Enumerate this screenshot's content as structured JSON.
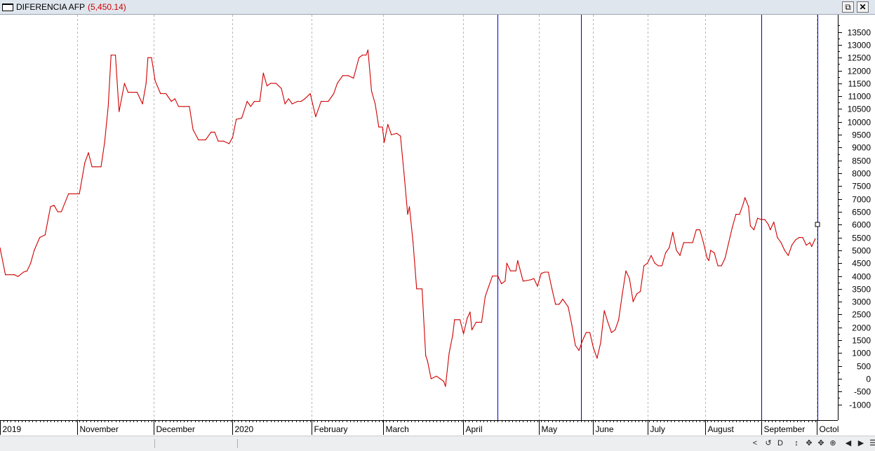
{
  "window": {
    "title": "DIFERENCIA AFP",
    "last_value": "(5,450.14)",
    "restore_icon": "restore-icon",
    "close_icon": "close-icon"
  },
  "colors": {
    "series": "#d00000",
    "markers": "#0000c8",
    "grid": "#b8b8b8",
    "axis": "#000000"
  },
  "chart_data": {
    "type": "line",
    "title": "DIFERENCIA AFP",
    "xlabel": "",
    "ylabel": "",
    "ylim": [
      -1500,
      14000
    ],
    "grid": "vertical dashed at month boundaries",
    "x_unit": "trading days",
    "x_range": [
      0,
      240
    ],
    "y_ticks": [
      -1000,
      -500,
      0,
      500,
      1000,
      1500,
      2000,
      2500,
      3000,
      3500,
      4000,
      4500,
      5000,
      5500,
      6000,
      6500,
      7000,
      7500,
      8000,
      8500,
      9000,
      9500,
      10000,
      10500,
      11000,
      11500,
      12000,
      12500,
      13000,
      13500
    ],
    "x_labels": [
      {
        "label": "2019",
        "x": 0
      },
      {
        "label": "November",
        "x": 21.4
      },
      {
        "label": "December",
        "x": 42.6
      },
      {
        "label": "2020",
        "x": 64.4
      },
      {
        "label": "February",
        "x": 86.4
      },
      {
        "label": "March",
        "x": 106.2
      },
      {
        "label": "April",
        "x": 128.3
      },
      {
        "label": "May",
        "x": 149.3
      },
      {
        "label": "June",
        "x": 164.3
      },
      {
        "label": "July",
        "x": 179.5
      },
      {
        "label": "August",
        "x": 195.5
      },
      {
        "label": "September",
        "x": 211
      },
      {
        "label": "Octol",
        "x": 226.4
      }
    ],
    "vertical_markers": [
      138,
      161,
      211,
      226.6
    ],
    "series": [
      {
        "points": [
          [
            0,
            5100
          ],
          [
            1.5,
            4050
          ],
          [
            4,
            4050
          ],
          [
            5,
            3980
          ],
          [
            6.5,
            4150
          ],
          [
            7.5,
            4200
          ],
          [
            8.5,
            4500
          ],
          [
            9.5,
            5000
          ],
          [
            11,
            5500
          ],
          [
            12.5,
            5600
          ],
          [
            14,
            6700
          ],
          [
            15,
            6750
          ],
          [
            16,
            6500
          ],
          [
            17,
            6500
          ],
          [
            19,
            7200
          ],
          [
            20,
            7200
          ],
          [
            22,
            7200
          ],
          [
            23.5,
            8400
          ],
          [
            24.5,
            8800
          ],
          [
            25.5,
            8250
          ],
          [
            26.5,
            8250
          ],
          [
            28,
            8250
          ],
          [
            29,
            9200
          ],
          [
            30,
            10600
          ],
          [
            30.8,
            12600
          ],
          [
            32,
            12600
          ],
          [
            33,
            10400
          ],
          [
            34.5,
            11500
          ],
          [
            35.5,
            11150
          ],
          [
            38,
            11150
          ],
          [
            39.5,
            10700
          ],
          [
            40.5,
            11500
          ],
          [
            41,
            12500
          ],
          [
            42,
            12500
          ],
          [
            43,
            11600
          ],
          [
            44.5,
            11100
          ],
          [
            46,
            11100
          ],
          [
            47.5,
            10800
          ],
          [
            48.5,
            10900
          ],
          [
            49.5,
            10600
          ],
          [
            51,
            10600
          ],
          [
            52.5,
            10600
          ],
          [
            53.5,
            9700
          ],
          [
            55,
            9300
          ],
          [
            57,
            9300
          ],
          [
            58.5,
            9600
          ],
          [
            59.5,
            9600
          ],
          [
            60.5,
            9250
          ],
          [
            62,
            9250
          ],
          [
            63.5,
            9150
          ],
          [
            64.5,
            9400
          ],
          [
            65.5,
            10100
          ],
          [
            67,
            10150
          ],
          [
            68.5,
            10800
          ],
          [
            69.5,
            10600
          ],
          [
            70.5,
            10800
          ],
          [
            72,
            10800
          ],
          [
            73,
            11900
          ],
          [
            74,
            11400
          ],
          [
            75,
            11500
          ],
          [
            76.5,
            11500
          ],
          [
            78,
            11300
          ],
          [
            79,
            10700
          ],
          [
            80,
            10900
          ],
          [
            81,
            10700
          ],
          [
            82.5,
            10800
          ],
          [
            83.5,
            10800
          ],
          [
            84.5,
            10900
          ],
          [
            86,
            11100
          ],
          [
            87.5,
            10200
          ],
          [
            89,
            10800
          ],
          [
            91,
            10800
          ],
          [
            92.5,
            11100
          ],
          [
            93.5,
            11500
          ],
          [
            95,
            11800
          ],
          [
            96.5,
            11800
          ],
          [
            98,
            11700
          ],
          [
            99.5,
            12500
          ],
          [
            100.5,
            12600
          ],
          [
            101.5,
            12600
          ],
          [
            102,
            12800
          ],
          [
            103,
            11200
          ],
          [
            104,
            10700
          ],
          [
            105,
            9800
          ],
          [
            106,
            9800
          ],
          [
            106.5,
            9200
          ],
          [
            107.5,
            9900
          ],
          [
            108.5,
            9500
          ],
          [
            110,
            9550
          ],
          [
            111,
            9450
          ],
          [
            112,
            8000
          ],
          [
            113,
            6400
          ],
          [
            113.5,
            6700
          ],
          [
            114.5,
            5300
          ],
          [
            115.5,
            3500
          ],
          [
            117,
            3500
          ],
          [
            118,
            900
          ],
          [
            118.5,
            700
          ],
          [
            119.5,
            0
          ],
          [
            121,
            100
          ],
          [
            122,
            0
          ],
          [
            123,
            -100
          ],
          [
            123.5,
            -300
          ],
          [
            124.5,
            1000
          ],
          [
            125.5,
            1700
          ],
          [
            126,
            2300
          ],
          [
            127.5,
            2300
          ],
          [
            128.5,
            1750
          ],
          [
            129.5,
            2350
          ],
          [
            130.3,
            2600
          ],
          [
            130.8,
            1900
          ],
          [
            132,
            2200
          ],
          [
            133.5,
            2200
          ],
          [
            134.5,
            3200
          ],
          [
            135.5,
            3600
          ],
          [
            136.5,
            4000
          ],
          [
            138,
            4000
          ],
          [
            139,
            3700
          ],
          [
            140,
            3800
          ],
          [
            140.5,
            4500
          ],
          [
            141.5,
            4200
          ],
          [
            143,
            4200
          ],
          [
            143.5,
            4600
          ],
          [
            145,
            3800
          ],
          [
            147,
            3850
          ],
          [
            148,
            3900
          ],
          [
            149,
            3600
          ],
          [
            150,
            4100
          ],
          [
            151,
            4150
          ],
          [
            152,
            4150
          ],
          [
            153,
            3500
          ],
          [
            154,
            2900
          ],
          [
            155,
            2900
          ],
          [
            156,
            3100
          ],
          [
            157.5,
            2800
          ],
          [
            158.5,
            2100
          ],
          [
            159.5,
            1300
          ],
          [
            160.5,
            1100
          ],
          [
            161.5,
            1500
          ],
          [
            162.5,
            1800
          ],
          [
            163.5,
            1800
          ],
          [
            164.5,
            1200
          ],
          [
            165.5,
            800
          ],
          [
            166.5,
            1400
          ],
          [
            167.5,
            2650
          ],
          [
            168.5,
            2200
          ],
          [
            169.5,
            1800
          ],
          [
            170.5,
            1900
          ],
          [
            171.5,
            2300
          ],
          [
            172.5,
            3300
          ],
          [
            173.5,
            4200
          ],
          [
            174.5,
            3900
          ],
          [
            175.5,
            3000
          ],
          [
            176.5,
            3300
          ],
          [
            177.5,
            3400
          ],
          [
            178.5,
            4400
          ],
          [
            179.5,
            4500
          ],
          [
            180.5,
            4800
          ],
          [
            181.5,
            4500
          ],
          [
            182.5,
            4400
          ],
          [
            183.5,
            4400
          ],
          [
            184.5,
            4900
          ],
          [
            185.5,
            5100
          ],
          [
            186.5,
            5700
          ],
          [
            187.5,
            5000
          ],
          [
            188.5,
            4800
          ],
          [
            189.5,
            5300
          ],
          [
            191,
            5300
          ],
          [
            192,
            5300
          ],
          [
            193,
            5800
          ],
          [
            194,
            5800
          ],
          [
            195,
            5300
          ],
          [
            196,
            4700
          ],
          [
            196.5,
            4600
          ],
          [
            197,
            5000
          ],
          [
            198,
            4900
          ],
          [
            199,
            4400
          ],
          [
            200,
            4400
          ],
          [
            201,
            4700
          ],
          [
            202,
            5300
          ],
          [
            203,
            5900
          ],
          [
            204,
            6400
          ],
          [
            205,
            6400
          ],
          [
            206,
            6800
          ],
          [
            206.5,
            7050
          ],
          [
            207.5,
            6700
          ],
          [
            208,
            5950
          ],
          [
            209,
            5800
          ],
          [
            210,
            6250
          ],
          [
            211,
            6200
          ],
          [
            212,
            6200
          ],
          [
            213,
            6000
          ],
          [
            213.5,
            5800
          ],
          [
            214.5,
            6100
          ],
          [
            215.5,
            5500
          ],
          [
            216.5,
            5300
          ],
          [
            217.5,
            5000
          ],
          [
            218.5,
            4800
          ],
          [
            219.5,
            5200
          ],
          [
            220.5,
            5400
          ],
          [
            221.5,
            5500
          ],
          [
            222.5,
            5500
          ],
          [
            223.5,
            5200
          ],
          [
            224.5,
            5300
          ],
          [
            225,
            5150
          ],
          [
            226,
            5450
          ]
        ]
      }
    ]
  },
  "statusbar": {
    "buttons": [
      "<",
      ">",
      "↺",
      "D",
      "↕",
      "✥",
      "⊕",
      "◀",
      "▶",
      "☰"
    ]
  }
}
